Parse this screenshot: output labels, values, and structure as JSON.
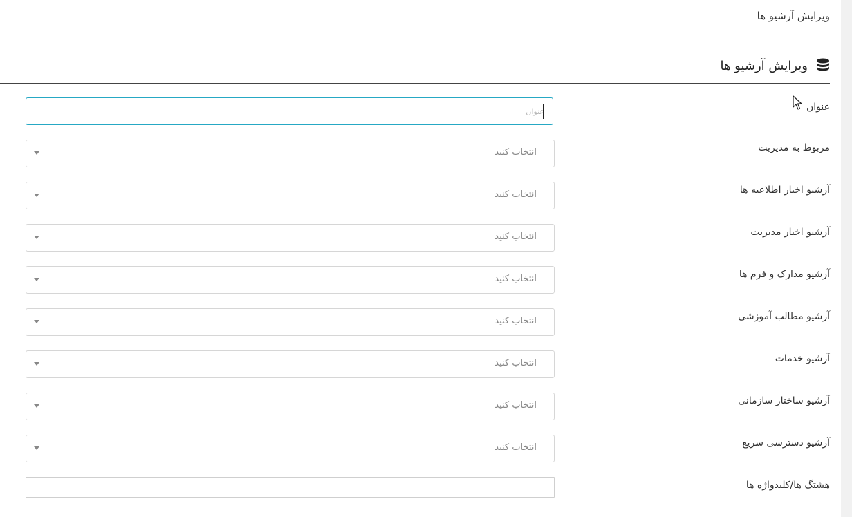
{
  "breadcrumb": "ویرایش آرشیو ها",
  "section": {
    "title": "ویرایش آرشیو ها",
    "icon": "database-icon"
  },
  "form": {
    "title_field": {
      "label": "عنوان",
      "placeholder": "عنوان",
      "value": ""
    },
    "select_fields": [
      {
        "label": "مربوط به مدیریت",
        "value": "انتخاب کنید"
      },
      {
        "label": "آرشیو اخبار اطلاعیه ها",
        "value": "انتخاب کنید"
      },
      {
        "label": "آرشیو اخبار مدیریت",
        "value": "انتخاب کنید"
      },
      {
        "label": "آرشیو مدارک و فرم ها",
        "value": "انتخاب کنید"
      },
      {
        "label": "آرشیو مطالب آموزشی",
        "value": "انتخاب کنید"
      },
      {
        "label": "آرشیو خدمات",
        "value": "انتخاب کنید"
      },
      {
        "label": "آرشیو ساختار سازمانی",
        "value": "انتخاب کنید"
      },
      {
        "label": "آرشیو دسترسی سریع",
        "value": "انتخاب کنید"
      }
    ],
    "tags_field": {
      "label": "هشتگ ها/کلیدواژه ها",
      "value": ""
    }
  },
  "colors": {
    "focus_border": "#26a8c4",
    "field_border": "#d6d6d6",
    "placeholder_text": "#888888"
  }
}
